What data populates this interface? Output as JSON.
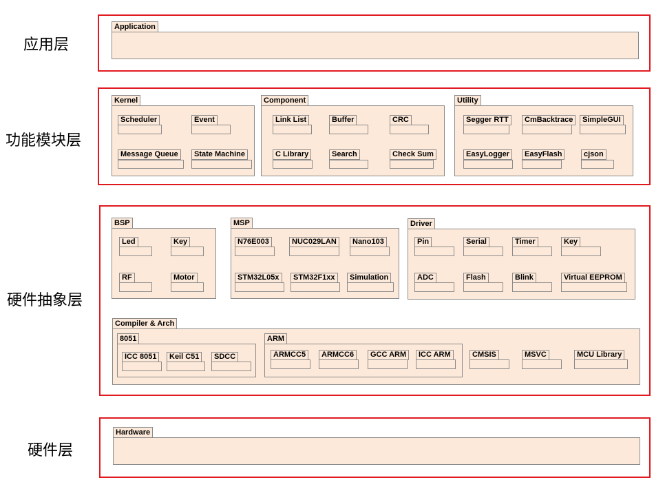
{
  "layers": {
    "application": {
      "label": "应用层",
      "package": "Application"
    },
    "function": {
      "label": "功能模块层",
      "kernel": {
        "name": "Kernel",
        "items": [
          "Scheduler",
          "Event",
          "Message Queue",
          "State Machine"
        ]
      },
      "component": {
        "name": "Component",
        "items": [
          "Link List",
          "Buffer",
          "CRC",
          "C Library",
          "Search",
          "Check Sum"
        ]
      },
      "utility": {
        "name": "Utility",
        "items": [
          "Segger RTT",
          "CmBacktrace",
          "SimpleGUI",
          "EasyLogger",
          "EasyFlash",
          "cjson"
        ]
      }
    },
    "hal": {
      "label": "硬件抽象层",
      "bsp": {
        "name": "BSP",
        "items": [
          "Led",
          "Key",
          "RF",
          "Motor"
        ]
      },
      "msp": {
        "name": "MSP",
        "items": [
          "N76E003",
          "NUC029LAN",
          "Nano103",
          "STM32L05x",
          "STM32F1xx",
          "Simulation"
        ]
      },
      "driver": {
        "name": "Driver",
        "items": [
          "Pin",
          "Serial",
          "Timer",
          "Key",
          "ADC",
          "Flash",
          "Blink",
          "Virtual EEPROM"
        ]
      },
      "compiler": {
        "name": "Compiler & Arch",
        "c8051": {
          "name": "8051",
          "items": [
            "ICC 8051",
            "Keil C51",
            "SDCC"
          ]
        },
        "arm": {
          "name": "ARM",
          "items": [
            "ARMCC5",
            "ARMCC6",
            "GCC ARM",
            "ICC ARM"
          ]
        },
        "others": [
          "CMSIS",
          "MSVC",
          "MCU Library"
        ]
      }
    },
    "hardware": {
      "label": "硬件层",
      "package": "Hardware"
    }
  },
  "colors": {
    "border_red": "#e0191f",
    "fill": "#fde9d9",
    "outline": "#8a8a8a"
  }
}
